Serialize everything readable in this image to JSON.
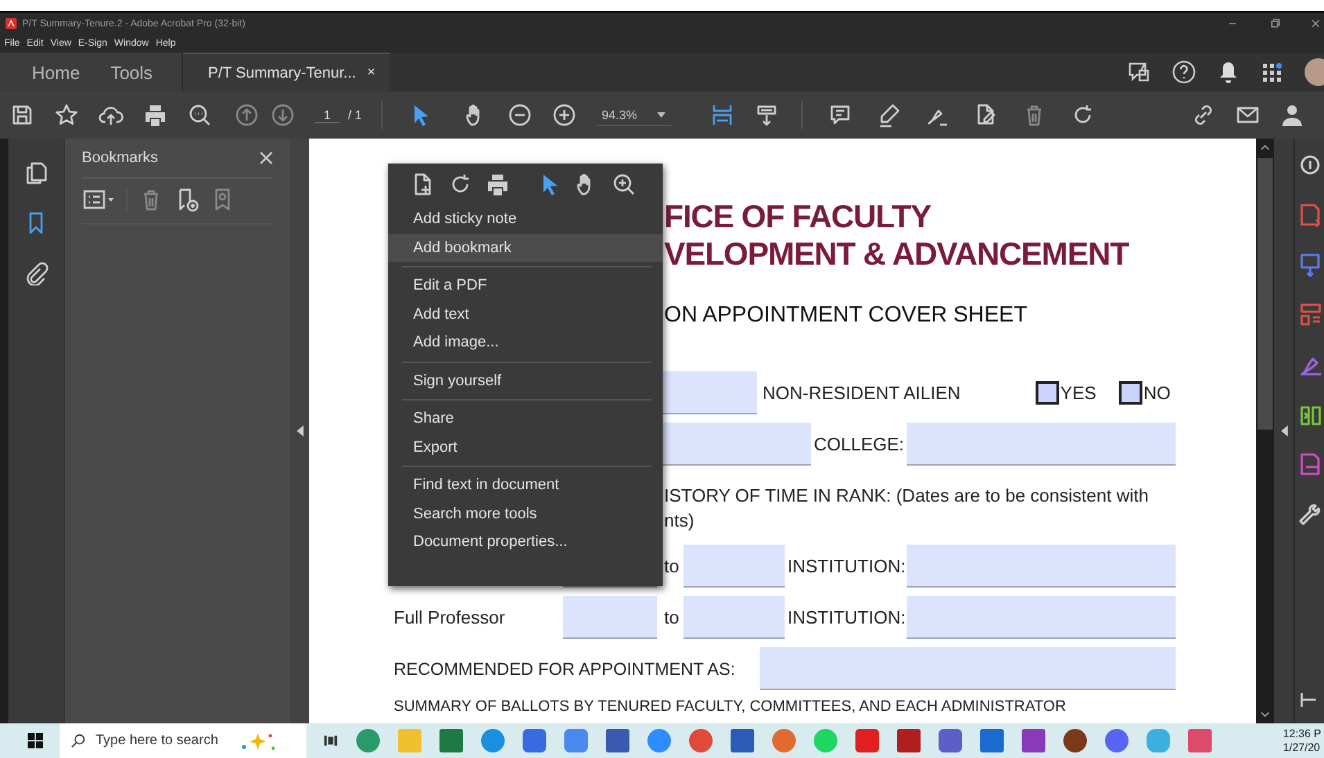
{
  "window": {
    "title": "P/T Summary-Tenure.2 - Adobe Acrobat Pro (32-bit)"
  },
  "menu_bar": [
    "File",
    "Edit",
    "View",
    "E-Sign",
    "Window",
    "Help"
  ],
  "tabs": [
    {
      "label": "Home",
      "selected": false
    },
    {
      "label": "Tools",
      "selected": false
    },
    {
      "label": "P/T Summary-Tenur...",
      "selected": true,
      "close": "×"
    }
  ],
  "toolbar": {
    "page": "1",
    "page_total": "/ 1",
    "zoom": "94.3%"
  },
  "bookmarks_panel": {
    "title": "Bookmarks"
  },
  "context_menu": {
    "groups": [
      {
        "items": [
          {
            "label": "Add sticky note",
            "selected": false
          },
          {
            "label": "Add bookmark",
            "selected": true
          }
        ]
      },
      {
        "items": [
          {
            "label": "Edit a PDF",
            "selected": false
          },
          {
            "label": "Add text",
            "selected": false
          },
          {
            "label": "Add image...",
            "selected": false
          }
        ]
      },
      {
        "items": [
          {
            "label": "Sign yourself",
            "selected": false
          }
        ]
      },
      {
        "items": [
          {
            "label": "Share",
            "selected": false
          },
          {
            "label": "Export",
            "selected": false
          }
        ]
      },
      {
        "items": [
          {
            "label": "Find text in document",
            "selected": false
          },
          {
            "label": "Search more tools",
            "selected": false
          },
          {
            "label": "Document properties...",
            "selected": false
          }
        ]
      }
    ]
  },
  "document": {
    "heading": [
      "FICE OF FACULTY",
      "VELOPMENT & ADVANCEMENT"
    ],
    "subtitle": "ON APPOINTMENT COVER SHEET",
    "residency": {
      "label": "NON-RESIDENT AILIEN",
      "options": [
        {
          "label": "YES",
          "checked": false
        },
        {
          "label": "NO",
          "checked": false
        }
      ]
    },
    "college_label": "COLLEGE:",
    "history_note": [
      "ISTORY OF TIME IN RANK: (Dates are to be consistent with",
      "nts)"
    ],
    "rank_rows": [
      {
        "to": "to",
        "institution": "INSTITUTION:"
      },
      {
        "rank": "Full Professor",
        "to": "to",
        "institution": "INSTITUTION:"
      }
    ],
    "recommended_label": "RECOMMENDED FOR APPOINTMENT AS:",
    "summary_heading": "SUMMARY OF BALLOTS BY TENURED FACULTY, COMMITTEES, AND EACH ADMINISTRATOR"
  },
  "taskbar": {
    "search_placeholder": "Type here to search",
    "time": "12:36 P",
    "date": "1/27/20"
  }
}
